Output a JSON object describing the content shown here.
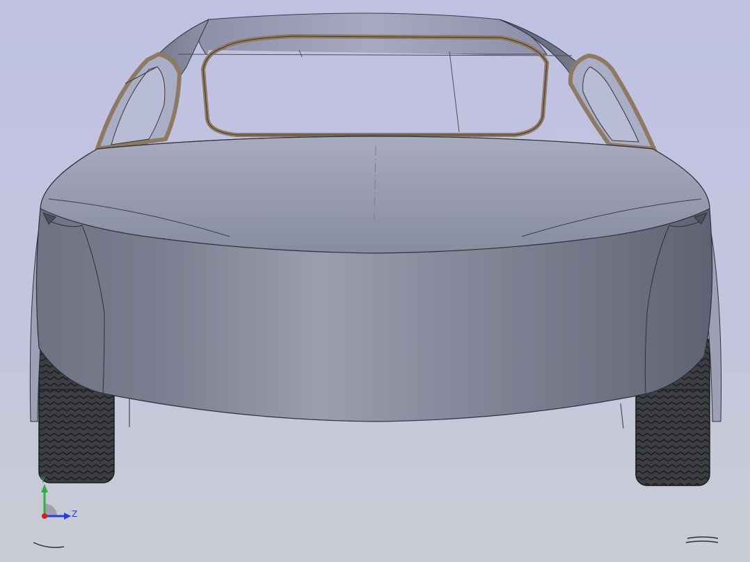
{
  "viewport": {
    "background_top": "#c0c1e2",
    "background_bottom": "#c9ccd4",
    "model_name": "car-body-rear-view",
    "body_color": "#868a9c",
    "trim_color": "#8e7a62",
    "tire_color": "#3a3c40"
  },
  "triad": {
    "y_label": "Y",
    "z_label": "Z",
    "y_color": "#2fae3a",
    "z_color": "#2a3bd6",
    "x_color": "#d21f1f"
  }
}
